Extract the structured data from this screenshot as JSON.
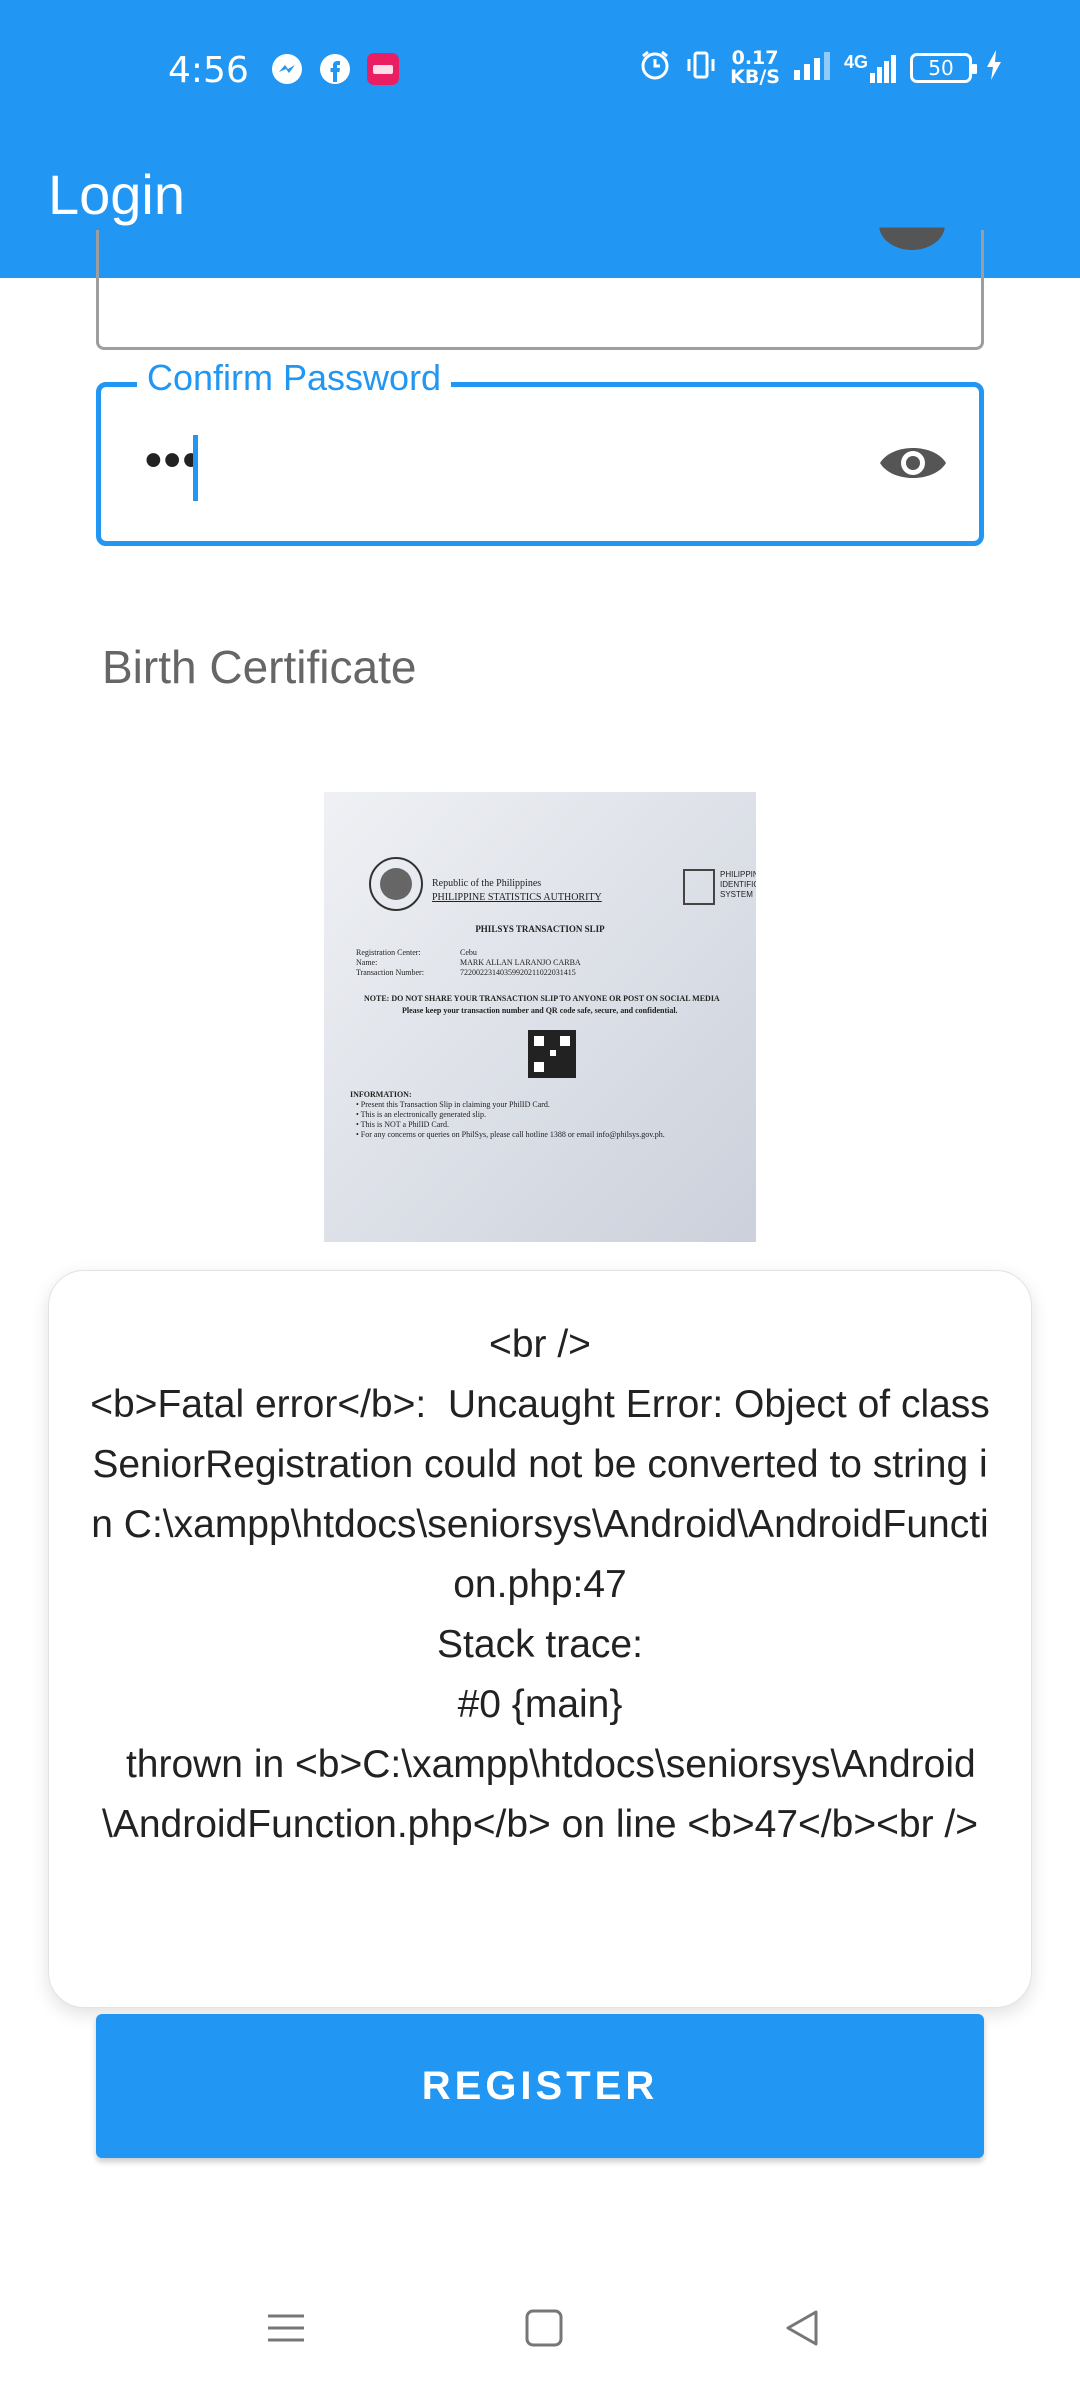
{
  "status_bar": {
    "time": "4:56",
    "network_speed_value": "0.17",
    "network_speed_unit": "KB/S",
    "network_type": "4G",
    "battery_level": "50",
    "icons": [
      "messenger-icon",
      "facebook-icon",
      "app-notification-icon",
      "alarm-icon",
      "vibrate-icon",
      "signal-icon",
      "signal-4g-icon",
      "battery-icon",
      "charging-icon"
    ],
    "color": "#2196F3"
  },
  "app_bar": {
    "title": "Login"
  },
  "form": {
    "confirm_password": {
      "label": "Confirm Password",
      "value": "•••"
    },
    "birth_certificate_label": "Birth Certificate"
  },
  "dialog": {
    "message": "<br />\n<b>Fatal error</b>:  Uncaught Error: Object of class SeniorRegistration could not be converted to string in C:\\xampp\\htdocs\\seniorsys\\Android\\AndroidFunction.php:47\nStack trace:\n#0 {main}\n  thrown in <b>C:\\xampp\\htdocs\\seniorsys\\Android\\AndroidFunction.php</b> on line <b>47</b><br />"
  },
  "register_button": {
    "label": "REGISTER"
  },
  "certificate_image": {
    "header_line1": "Republic of the Philippines",
    "header_line2": "PHILIPPINE STATISTICS AUTHORITY",
    "side_label": "PHILIPPINE IDENTIFICATION SYSTEM",
    "title": "PHILSYS TRANSACTION SLIP",
    "field1_label": "Registration Center:",
    "field1_value": "Cebu",
    "field2_label": "Name:",
    "field2_value": "MARK ALLAN LARANJO CARBA",
    "field3_label": "Transaction Number:",
    "field3_value": "72200223140359920211022031415",
    "note": "NOTE: DO NOT SHARE YOUR TRANSACTION SLIP TO ANYONE OR POST ON SOCIAL MEDIA",
    "note2": "Please keep your transaction number and QR code safe, secure, and confidential.",
    "info_title": "INFORMATION:",
    "info1": "• Present this Transaction Slip in claiming your PhilID Card.",
    "info2": "• This is an electronically generated slip.",
    "info3": "• This is NOT a PhilID Card.",
    "info4": "• For any concerns or queries on PhilSys, please call hotline 1388 or email info@philsys.gov.ph."
  }
}
